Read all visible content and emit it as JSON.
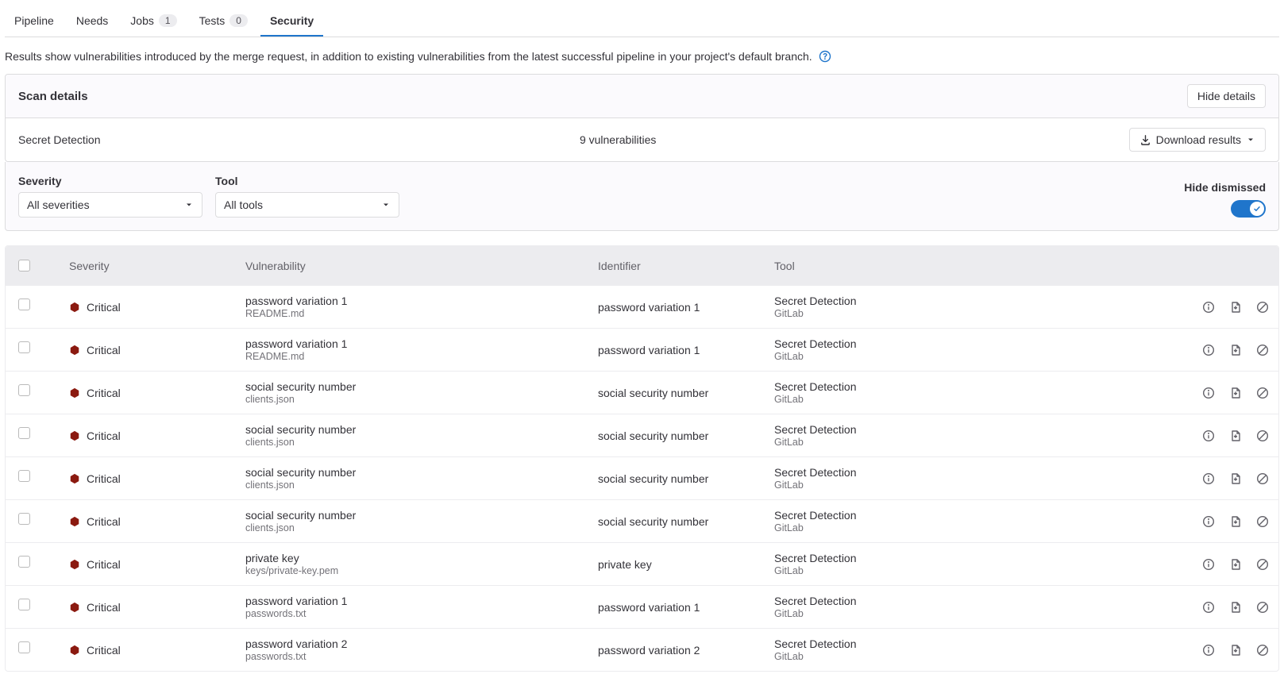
{
  "tabs": [
    {
      "label": "Pipeline",
      "badge": null,
      "active": false
    },
    {
      "label": "Needs",
      "badge": null,
      "active": false
    },
    {
      "label": "Jobs",
      "badge": "1",
      "active": false
    },
    {
      "label": "Tests",
      "badge": "0",
      "active": false
    },
    {
      "label": "Security",
      "badge": null,
      "active": true
    }
  ],
  "description": "Results show vulnerabilities introduced by the merge request, in addition to existing vulnerabilities from the latest successful pipeline in your project's default branch.",
  "scan_panel": {
    "title": "Scan details",
    "hide_button": "Hide details",
    "scanner": "Secret Detection",
    "count_text": "9 vulnerabilities",
    "download_button": "Download results"
  },
  "filters": {
    "severity_label": "Severity",
    "severity_value": "All severities",
    "tool_label": "Tool",
    "tool_value": "All tools",
    "dismissed_label": "Hide dismissed"
  },
  "columns": {
    "severity": "Severity",
    "vulnerability": "Vulnerability",
    "identifier": "Identifier",
    "tool": "Tool"
  },
  "rows": [
    {
      "severity": "Critical",
      "title": "password variation 1",
      "file": "README.md",
      "identifier": "password variation 1",
      "tool": "Secret Detection",
      "vendor": "GitLab"
    },
    {
      "severity": "Critical",
      "title": "password variation 1",
      "file": "README.md",
      "identifier": "password variation 1",
      "tool": "Secret Detection",
      "vendor": "GitLab"
    },
    {
      "severity": "Critical",
      "title": "social security number",
      "file": "clients.json",
      "identifier": "social security number",
      "tool": "Secret Detection",
      "vendor": "GitLab"
    },
    {
      "severity": "Critical",
      "title": "social security number",
      "file": "clients.json",
      "identifier": "social security number",
      "tool": "Secret Detection",
      "vendor": "GitLab"
    },
    {
      "severity": "Critical",
      "title": "social security number",
      "file": "clients.json",
      "identifier": "social security number",
      "tool": "Secret Detection",
      "vendor": "GitLab"
    },
    {
      "severity": "Critical",
      "title": "social security number",
      "file": "clients.json",
      "identifier": "social security number",
      "tool": "Secret Detection",
      "vendor": "GitLab"
    },
    {
      "severity": "Critical",
      "title": "private key",
      "file": "keys/private-key.pem",
      "identifier": "private key",
      "tool": "Secret Detection",
      "vendor": "GitLab"
    },
    {
      "severity": "Critical",
      "title": "password variation 1",
      "file": "passwords.txt",
      "identifier": "password variation 1",
      "tool": "Secret Detection",
      "vendor": "GitLab"
    },
    {
      "severity": "Critical",
      "title": "password variation 2",
      "file": "passwords.txt",
      "identifier": "password variation 2",
      "tool": "Secret Detection",
      "vendor": "GitLab"
    }
  ]
}
